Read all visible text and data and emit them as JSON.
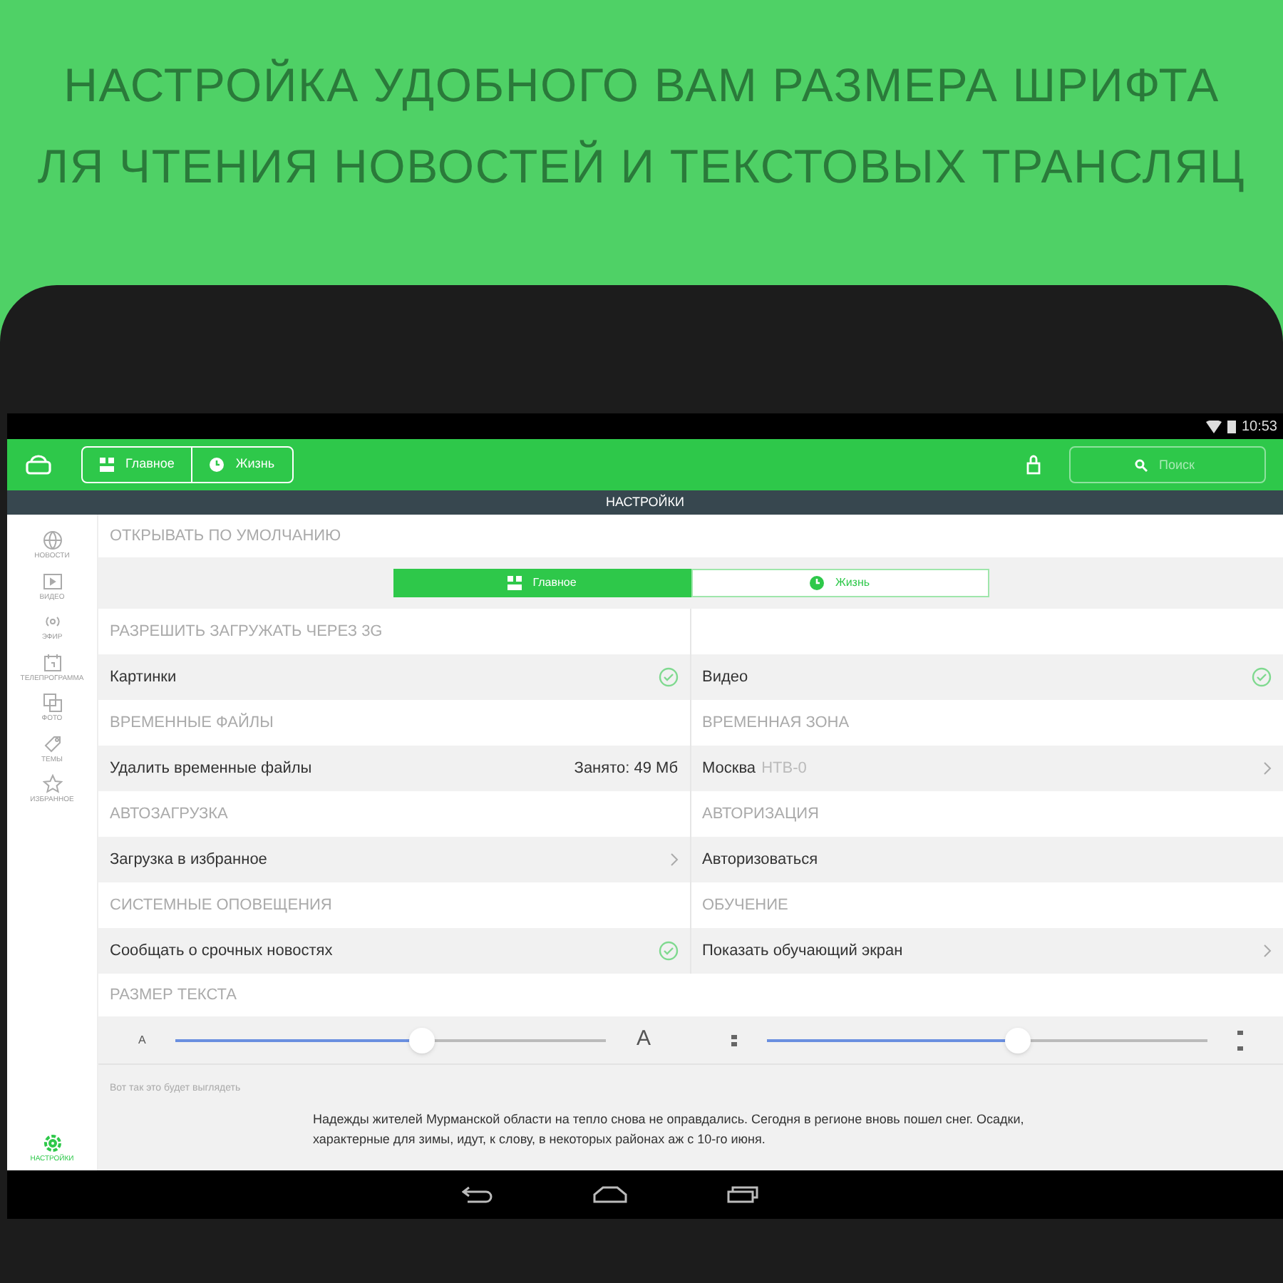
{
  "headline": [
    "НАСТРОЙКА УДОБНОГО ВАМ РАЗМЕРА ШРИФТА",
    "ЛЯ ЧТЕНИЯ НОВОСТЕЙ И ТЕКСТОВЫХ ТРАНСЛЯЦ"
  ],
  "status_bar": {
    "time": "10:53"
  },
  "app_bar": {
    "tabs": [
      {
        "label": "Главное",
        "kind": "grid"
      },
      {
        "label": "Жизнь",
        "kind": "clock"
      }
    ],
    "search": {
      "placeholder": "Поиск"
    }
  },
  "title_bar": "НАСТРОЙКИ",
  "sidebar": {
    "items": [
      {
        "label": "НОВОСТИ",
        "kind": "globe",
        "selected": false
      },
      {
        "label": "ВИДЕО",
        "kind": "play",
        "selected": false
      },
      {
        "label": "ЭФИР",
        "kind": "radio",
        "selected": false
      },
      {
        "label": "ТЕЛЕПРОГРАММА",
        "kind": "calendar",
        "selected": false
      },
      {
        "label": "ФОТО",
        "kind": "photo",
        "selected": false
      },
      {
        "label": "ТЕМЫ",
        "kind": "tag",
        "selected": false
      },
      {
        "label": "ИЗБРАННОЕ",
        "kind": "star",
        "selected": false
      }
    ],
    "bottom": {
      "label": "НАСТРОЙКИ",
      "kind": "gear",
      "selected": true
    }
  },
  "default_open": {
    "header": "ОТКРЫВАТЬ ПО УМОЛЧАНИЮ",
    "options": [
      {
        "label": "Главное",
        "kind": "grid",
        "selected": true
      },
      {
        "label": "Жизнь",
        "kind": "clock",
        "selected": false
      }
    ]
  },
  "settings_rows": [
    {
      "cells": [
        {
          "header": "РАЗРЕШИТЬ ЗАГРУЖАТЬ ЧЕРЕЗ 3G",
          "label": "Картинки",
          "kind": "check",
          "checked": true
        },
        {
          "label": "Видео",
          "kind": "check",
          "checked": true
        }
      ]
    },
    {
      "cells": [
        {
          "header": "ВРЕМЕННЫЕ ФАЙЛЫ",
          "label": "Удалить временные файлы",
          "kind": "value",
          "value": "Занято: 49 Мб"
        },
        {
          "header": "ВРЕМЕННАЯ ЗОНА",
          "label": "Москва",
          "note": "НТВ-0",
          "kind": "chevron"
        }
      ]
    },
    {
      "cells": [
        {
          "header": "АВТОЗАГРУЗКА",
          "label": "Загрузка в избранное",
          "kind": "chevron"
        },
        {
          "header": "АВТОРИЗАЦИЯ",
          "label": "Авторизоваться",
          "kind": "plain"
        }
      ]
    },
    {
      "cells": [
        {
          "header": "СИСТЕМНЫЕ ОПОВЕЩЕНИЯ",
          "label": "Сообщать о срочных новостях",
          "kind": "check",
          "checked": true
        },
        {
          "header": "ОБУЧЕНИЕ",
          "label": "Показать обучающий экран",
          "kind": "chevron"
        }
      ]
    }
  ],
  "text_size": {
    "header": "РАЗМЕР ТЕКСТА",
    "font_slider": {
      "small": "A",
      "large": "A",
      "level": 0.57
    },
    "spacing_slider": {
      "level": 0.57
    }
  },
  "preview": {
    "label": "Вот так это будет выглядеть",
    "text": "Надежды жителей Мурманской области на тепло снова не оправдались. Сегодня в регионе вновь пошел снег. Осадки, характерные для зимы, идут, к слову, в некоторых районах аж с 10-го июня."
  }
}
